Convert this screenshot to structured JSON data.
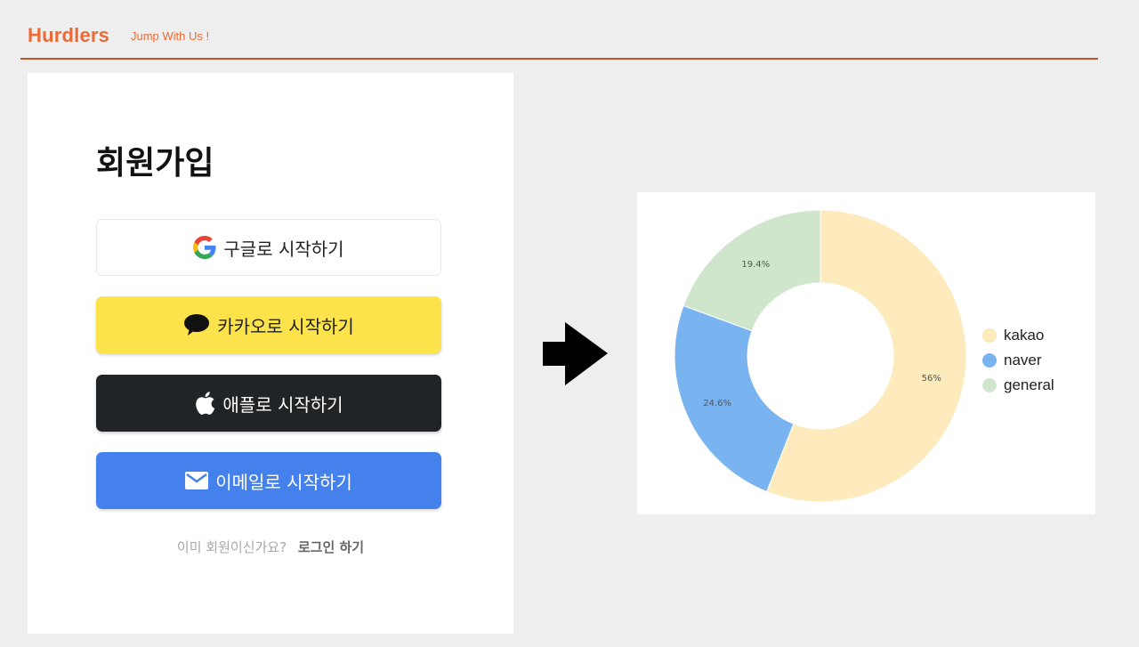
{
  "header": {
    "brand": "Hurdlers",
    "tagline": "Jump With Us !"
  },
  "signup": {
    "title": "회원가입",
    "buttons": {
      "google": "구글로 시작하기",
      "kakao": "카카오로 시작하기",
      "apple": "애플로 시작하기",
      "email": "이메일로 시작하기"
    },
    "login_prompt": "이미 회원이신가요?",
    "login_link": "로그인 하기"
  },
  "colors": {
    "brand": "#ec6a35",
    "kakao": "#fde34b",
    "apple": "#212426",
    "email": "#4481ec"
  },
  "icons": {
    "google": "google-g-icon",
    "kakao": "speech-bubble-icon",
    "apple": "apple-logo-icon",
    "email": "envelope-icon",
    "arrow": "right-arrow-icon"
  },
  "chart_data": {
    "type": "pie",
    "donut": true,
    "legend_position": "right",
    "series": [
      {
        "name": "kakao",
        "value": 56,
        "label": "56%",
        "color": "#fdebbd"
      },
      {
        "name": "naver",
        "value": 24.6,
        "label": "24.6%",
        "color": "#79b3f0"
      },
      {
        "name": "general",
        "value": 19.4,
        "label": "19.4%",
        "color": "#cfe5cc"
      }
    ]
  }
}
